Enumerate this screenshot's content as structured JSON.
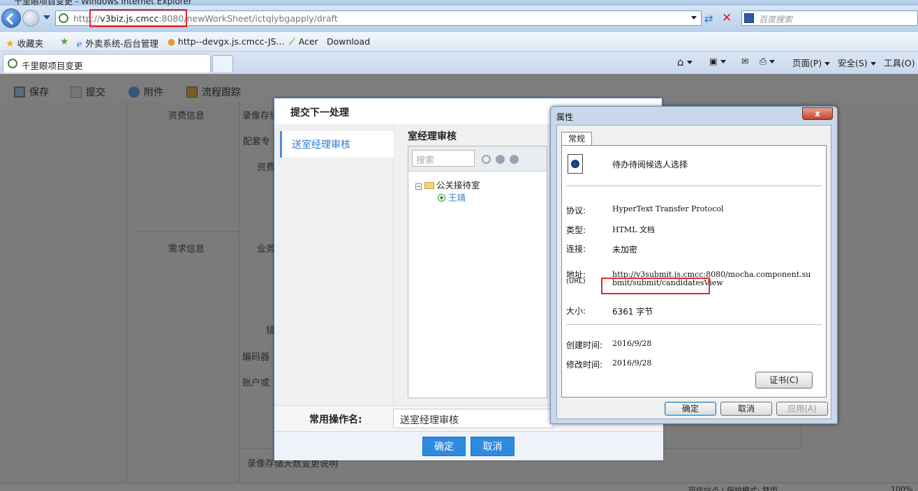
{
  "window": {
    "title": "千里眼项目变更 - Windows Internet Explorer"
  },
  "address": {
    "prefix": "http://",
    "host": "v3biz.js.cmcc",
    "rest": ":8080/newWorkSheet/ictqlybgapply/draft"
  },
  "search": {
    "placeholder": "百度搜索"
  },
  "favorites": {
    "label": "收藏夹",
    "items": [
      "外卖系统-后台管理",
      "http--devgx.js.cmcc-JS...",
      "Acer",
      "Download"
    ]
  },
  "tab": {
    "title": "千里眼项目变更"
  },
  "commands": {
    "page": "页面(P)",
    "safety": "安全(S)",
    "tools": "工具(O)"
  },
  "toolbar": {
    "save": "保存",
    "submit": "提交",
    "attach": "附件",
    "track": "流程跟踪"
  },
  "form": {
    "labels": [
      "资费信息",
      "录像存储",
      "配套专",
      "资费",
      "需求信息",
      "业务",
      "镜",
      "编码器",
      "账户或",
      "录像存储天数变更说明"
    ]
  },
  "submit_dialog": {
    "title": "提交下一处理",
    "left_item": "送室经理审核",
    "right_title": "室经理审核",
    "search_placeholder": "搜索",
    "tree": {
      "group": "公关接待室",
      "person": "王靖"
    },
    "op_label": "常用操作名:",
    "op_value": "送室经理审核",
    "ok": "确定",
    "cancel": "取消"
  },
  "properties_dialog": {
    "title": "属性",
    "close": "x",
    "tab": "常规",
    "name": "待办待阅候选人选择",
    "rows": [
      {
        "key": "协议:",
        "value": "HyperText Transfer Protocol"
      },
      {
        "key": "类型:",
        "value": "HTML 文档"
      },
      {
        "key": "连接:",
        "value": "未加密"
      }
    ],
    "address_key": "地址:",
    "address_key_sub": "(URL)",
    "address_line1": "http://v3submit.js.cmcc:8080/mocha.component.su",
    "address_line2": "bmit/submit/candidatesView",
    "size_key": "大小:",
    "size_value": "6361 字节",
    "created_key": "创建时间:",
    "created_value": "2016/9/28",
    "modified_key": "修改时间:",
    "modified_value": "2016/9/28",
    "cert_button": "证书(C)",
    "ok": "确定",
    "cancel": "取消",
    "apply": "应用(A)"
  },
  "status": {
    "zone": "可信站点 | 保护模式: 禁用",
    "zoom": "100%"
  }
}
